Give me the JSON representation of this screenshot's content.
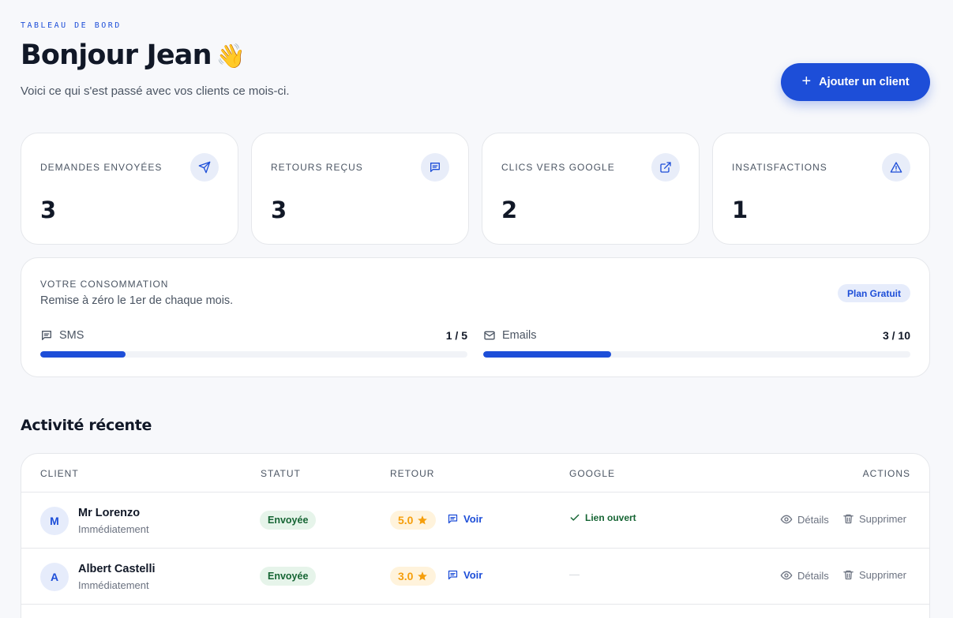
{
  "header": {
    "eyebrow": "TABLEAU DE BORD",
    "title": "Bonjour Jean",
    "emoji": "👋",
    "subtitle": "Voici ce qui s'est passé avec vos clients ce mois-ci.",
    "add_button_label": "Ajouter un client"
  },
  "stats": [
    {
      "label": "Demandes envoyées",
      "value": "3",
      "icon": "send-icon"
    },
    {
      "label": "Retours reçus",
      "value": "3",
      "icon": "message-icon"
    },
    {
      "label": "Clics vers Google",
      "value": "2",
      "icon": "external-link-icon"
    },
    {
      "label": "Insatisfactions",
      "value": "1",
      "icon": "warning-icon"
    }
  ],
  "usage": {
    "title": "VOTRE CONSOMMATION",
    "subtitle": "Remise à zéro le 1er de chaque mois.",
    "plan": "Plan Gratuit",
    "meters": [
      {
        "name": "SMS",
        "count": "1 / 5",
        "used": 1,
        "total": 5,
        "icon": "message-icon"
      },
      {
        "name": "Emails",
        "count": "3 / 10",
        "used": 3,
        "total": 10,
        "icon": "mail-icon"
      }
    ]
  },
  "activity": {
    "title": "Activité récente",
    "columns": {
      "client": "CLIENT",
      "status": "STATUT",
      "feedback": "RETOUR",
      "google": "GOOGLE",
      "actions": "ACTIONS"
    },
    "rows": [
      {
        "initial": "M",
        "name": "Mr Lorenzo",
        "when": "Immédiatement",
        "status": "Envoyée",
        "rating": "5.0",
        "view": "Voir",
        "google": "Lien ouvert",
        "details": "Détails",
        "delete": "Supprimer"
      },
      {
        "initial": "A",
        "name": "Albert Castelli",
        "when": "Immédiatement",
        "status": "Envoyée",
        "rating": "3.0",
        "view": "Voir",
        "google": "—",
        "details": "Détails",
        "delete": "Supprimer"
      }
    ]
  },
  "colors": {
    "accent": "#1d4ed8",
    "success": "#166534",
    "star": "#f59e0b"
  }
}
